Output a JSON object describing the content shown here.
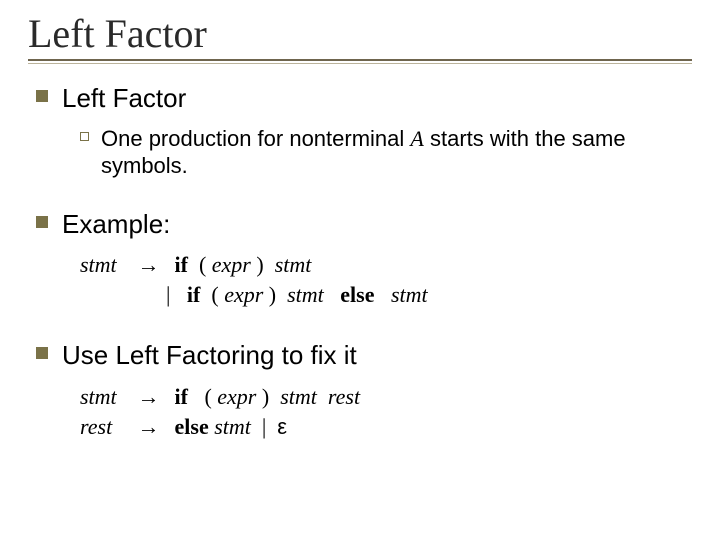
{
  "title": "Left Factor",
  "sections": {
    "s1": {
      "heading": "Left Factor",
      "sub": {
        "pre": "One production for nonterminal ",
        "nt": "A",
        "post": " starts with the same symbols."
      }
    },
    "s2": {
      "heading": "Example:",
      "grammar": {
        "lhs": "stmt",
        "arrow": "→",
        "if": "if",
        "lp": "(",
        "rp": ")",
        "expr": "expr",
        "stmt": "stmt",
        "else": "else",
        "pipe": "|"
      }
    },
    "s3": {
      "heading": "Use Left Factoring to fix it",
      "grammar": {
        "lhs1": "stmt",
        "lhs2": "rest",
        "arrow": "→",
        "if": "if",
        "lp": "(",
        "rp": ")",
        "expr": "expr",
        "stmt": "stmt",
        "rest": "rest",
        "else": "else",
        "pipe": "|",
        "eps": "ε"
      }
    }
  }
}
